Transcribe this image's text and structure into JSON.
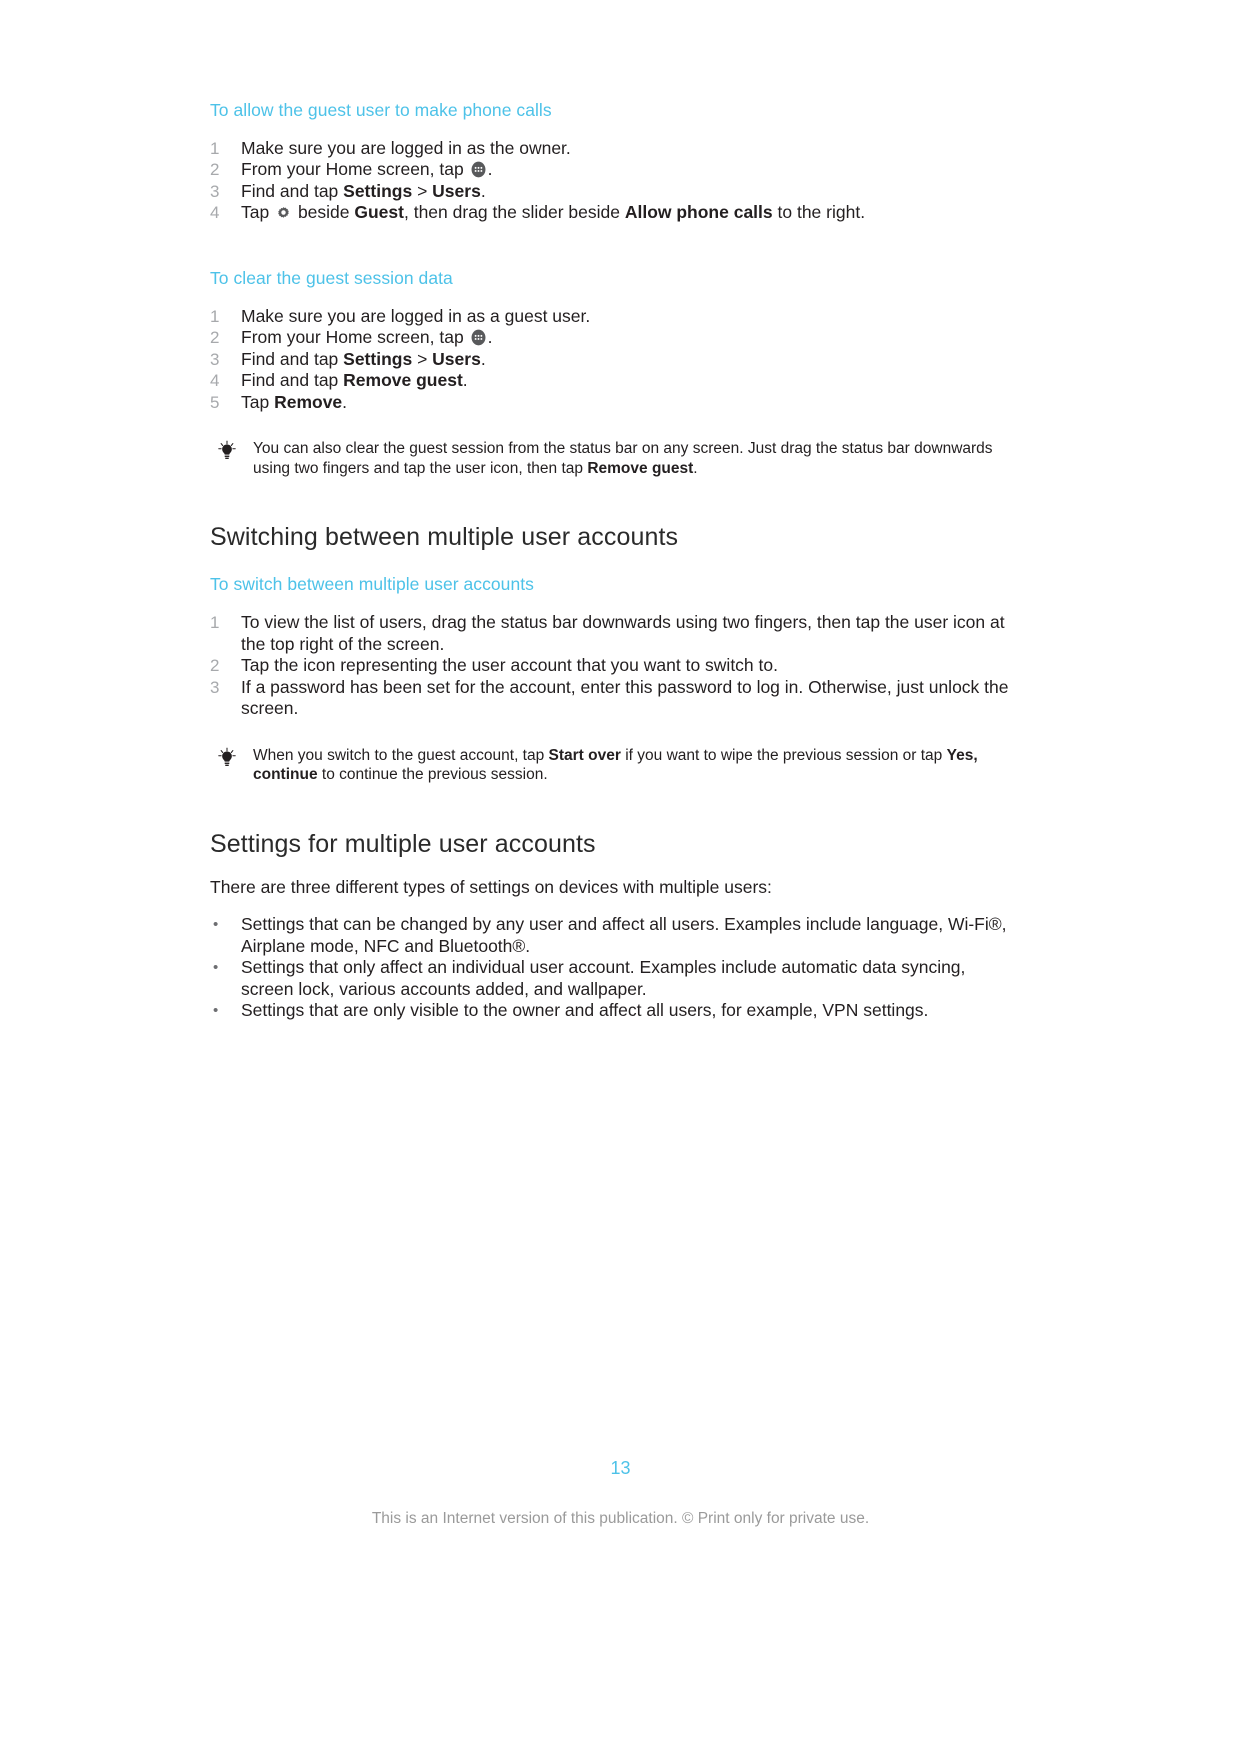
{
  "document": {
    "page_number": "13",
    "footer_note": "This is an Internet version of this publication. © Print only for private use.",
    "accent_color": "#4dc2e8",
    "text_color": "#231f20",
    "muted_color": "#a7a9ac"
  },
  "proc_phone_calls": {
    "heading": "To allow the guest user to make phone calls",
    "steps": [
      {
        "num": "1",
        "pre": "Make sure you are logged in as the owner.",
        "post": ""
      },
      {
        "num": "2",
        "pre": "From your Home screen, tap ",
        "icon": "app-drawer-icon",
        "post": "."
      },
      {
        "num": "3",
        "pre": "Find and tap ",
        "bold1": "Settings",
        "mid": " > ",
        "bold2": "Users",
        "post": "."
      },
      {
        "num": "4",
        "pre": "Tap ",
        "icon": "gear-icon",
        "mid": " beside ",
        "bold1": "Guest",
        "mid2": ", then drag the slider beside ",
        "bold2": "Allow phone calls",
        "post": " to the right."
      }
    ]
  },
  "proc_clear_session": {
    "heading": "To clear the guest session data",
    "steps": [
      {
        "num": "1",
        "pre": "Make sure you are logged in as a guest user.",
        "post": ""
      },
      {
        "num": "2",
        "pre": "From your Home screen, tap ",
        "icon": "app-drawer-icon",
        "post": "."
      },
      {
        "num": "3",
        "pre": "Find and tap ",
        "bold1": "Settings",
        "mid": " > ",
        "bold2": "Users",
        "post": "."
      },
      {
        "num": "4",
        "pre": "Find and tap ",
        "bold1": "Remove guest",
        "post": "."
      },
      {
        "num": "5",
        "pre": "Tap ",
        "bold1": "Remove",
        "post": "."
      }
    ],
    "tip": {
      "icon": "lightbulb-icon",
      "pre": "You can also clear the guest session from the status bar on any screen. Just drag the status bar downwards using two fingers and tap the user icon, then tap ",
      "bold": "Remove guest",
      "post": "."
    }
  },
  "section_switching": {
    "heading": "Switching between multiple user accounts",
    "proc": {
      "heading": "To switch between multiple user accounts",
      "steps": [
        {
          "num": "1",
          "text": "To view the list of users, drag the status bar downwards using two fingers, then tap the user icon at the top right of the screen."
        },
        {
          "num": "2",
          "text": "Tap the icon representing the user account that you want to switch to."
        },
        {
          "num": "3",
          "text": "If a password has been set for the account, enter this password to log in. Otherwise, just unlock the screen."
        }
      ],
      "tip": {
        "icon": "lightbulb-icon",
        "pre": "When you switch to the guest account, tap ",
        "bold1": "Start over",
        "mid": " if you want to wipe the previous session or tap ",
        "bold2": "Yes, continue",
        "post": " to continue the previous session."
      }
    }
  },
  "section_settings": {
    "heading": "Settings for multiple user accounts",
    "intro": "There are three different types of settings on devices with multiple users:",
    "bullets": [
      "Settings that can be changed by any user and affect all users. Examples include language, Wi-Fi®, Airplane mode, NFC and Bluetooth®.",
      "Settings that only affect an individual user account. Examples include automatic data syncing, screen lock, various accounts added, and wallpaper.",
      "Settings that are only visible to the owner and affect all users, for example, VPN settings."
    ],
    "bullet_glyph": "•"
  }
}
